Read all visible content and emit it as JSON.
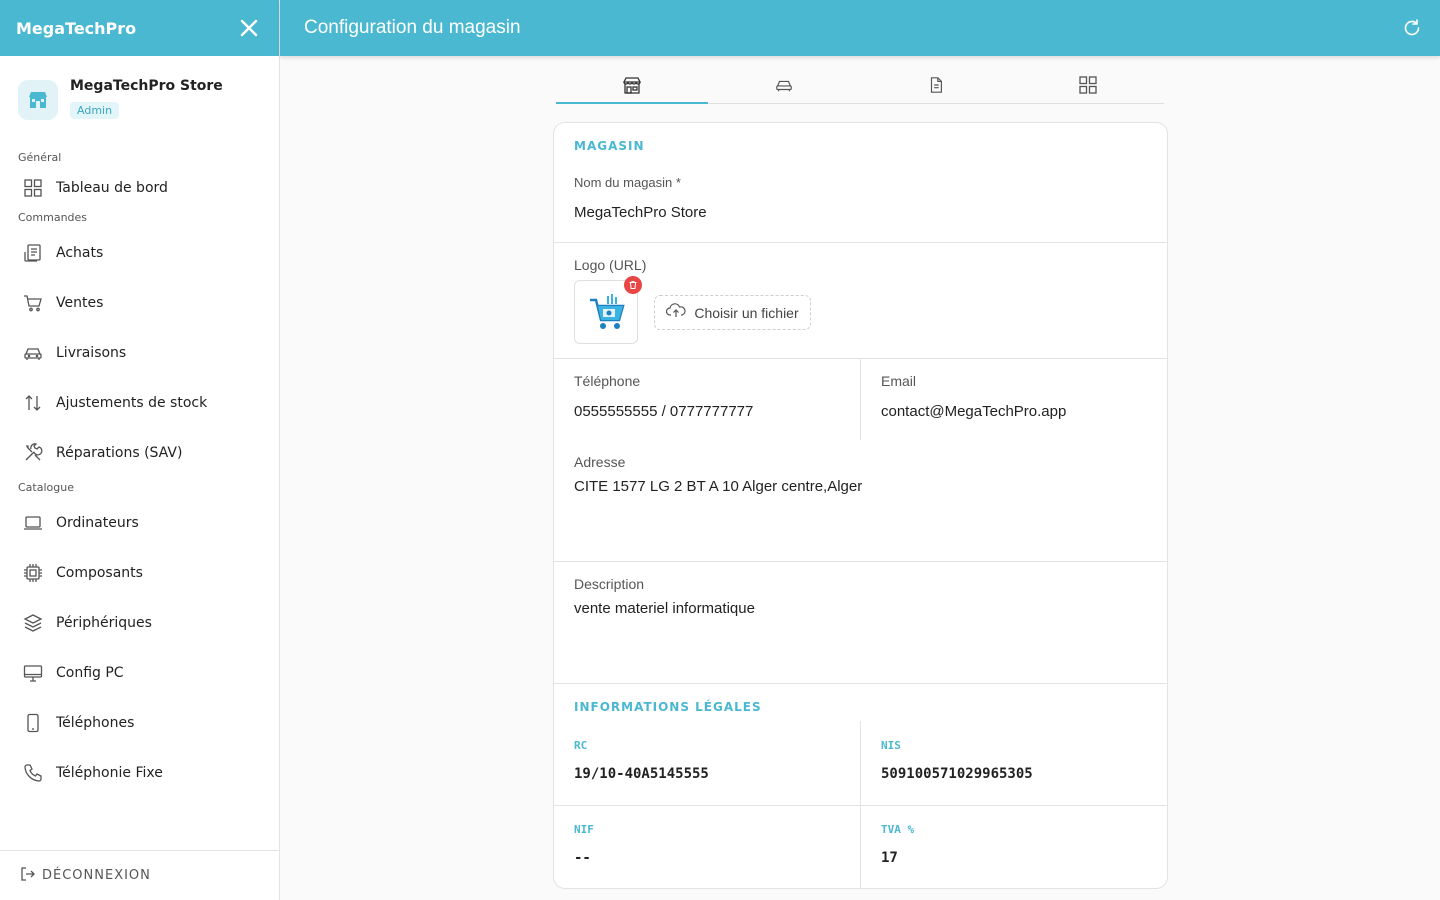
{
  "sidebar": {
    "brand": "MegaTechPro",
    "store_name": "MegaTechPro Store",
    "store_role": "Admin",
    "sections": [
      {
        "title": "Général",
        "items": [
          {
            "label": "Tableau de bord",
            "icon": "dashboard-icon"
          }
        ]
      },
      {
        "title": "Commandes",
        "items": [
          {
            "label": "Achats",
            "icon": "receipt-icon"
          },
          {
            "label": "Ventes",
            "icon": "cart-icon"
          },
          {
            "label": "Livraisons",
            "icon": "car-icon"
          },
          {
            "label": "Ajustements de stock",
            "icon": "arrows-updown-icon"
          },
          {
            "label": "Réparations (SAV)",
            "icon": "tools-icon"
          }
        ]
      },
      {
        "title": "Catalogue",
        "items": [
          {
            "label": "Ordinateurs",
            "icon": "laptop-icon"
          },
          {
            "label": "Composants",
            "icon": "chip-icon"
          },
          {
            "label": "Périphériques",
            "icon": "layers-icon"
          },
          {
            "label": "Config PC",
            "icon": "monitor-icon"
          },
          {
            "label": "Téléphones",
            "icon": "smartphone-icon"
          },
          {
            "label": "Téléphonie Fixe",
            "icon": "phone-icon"
          }
        ]
      }
    ],
    "logout_label": "DÉCONNEXION"
  },
  "topbar": {
    "title": "Configuration du magasin"
  },
  "tabs": [
    {
      "icon": "store-icon",
      "active": true
    },
    {
      "icon": "car-icon",
      "active": false
    },
    {
      "icon": "document-icon",
      "active": false
    },
    {
      "icon": "grid-icon",
      "active": false
    }
  ],
  "form": {
    "section_store": "MAGASIN",
    "name_label": "Nom du magasin *",
    "name_value": "MegaTechPro Store",
    "logo_label": "Logo (URL)",
    "upload_label": "Choisir un fichier",
    "phone_label": "Téléphone",
    "phone_value": "0555555555 / 0777777777",
    "email_label": "Email",
    "email_value": "contact@MegaTechPro.app",
    "address_label": "Adresse",
    "address_value": "CITE 1577 LG 2 BT A 10 Alger centre,Alger",
    "description_label": "Description",
    "description_value": "vente materiel informatique",
    "section_legal": "INFORMATIONS LÉGALES",
    "rc_label": "RC",
    "rc_value": "19/10-40A5145555",
    "nis_label": "NIS",
    "nis_value": "509100571029965305",
    "nif_label": "NIF",
    "nif_value": "--",
    "tva_label": "TVA %",
    "tva_value": "17"
  },
  "colors": {
    "accent": "#4ab8d0",
    "danger": "#e84545"
  }
}
